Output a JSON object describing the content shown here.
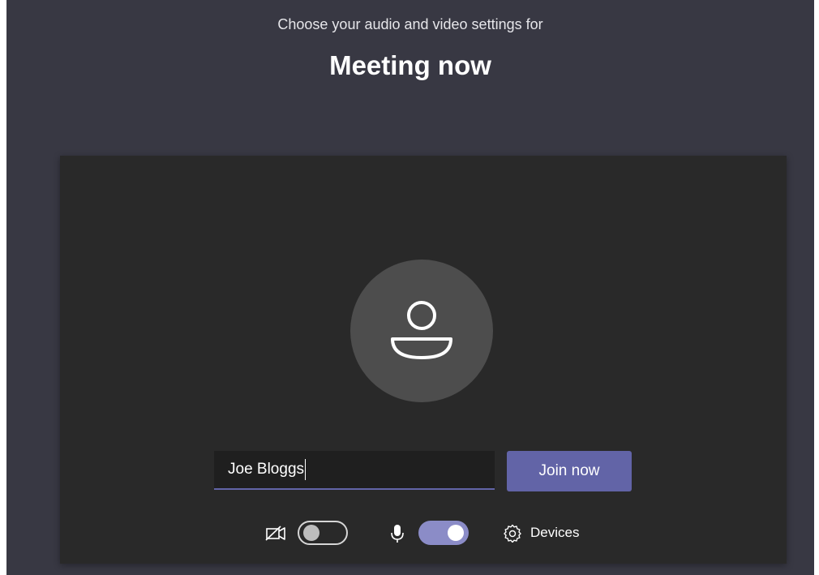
{
  "header": {
    "subtitle": "Choose your audio and video settings for",
    "meeting_title": "Meeting now"
  },
  "name_field": {
    "value": "Joe Bloggs"
  },
  "join_button": {
    "label": "Join now"
  },
  "controls": {
    "camera": {
      "icon": "camera-off-icon",
      "state": "off"
    },
    "microphone": {
      "icon": "microphone-icon",
      "state": "on"
    },
    "devices": {
      "icon": "gear-icon",
      "label": "Devices"
    }
  },
  "colors": {
    "background": "#383843",
    "panel": "#292929",
    "accent": "#6264a7",
    "toggle_on": "#8b8cc7"
  }
}
